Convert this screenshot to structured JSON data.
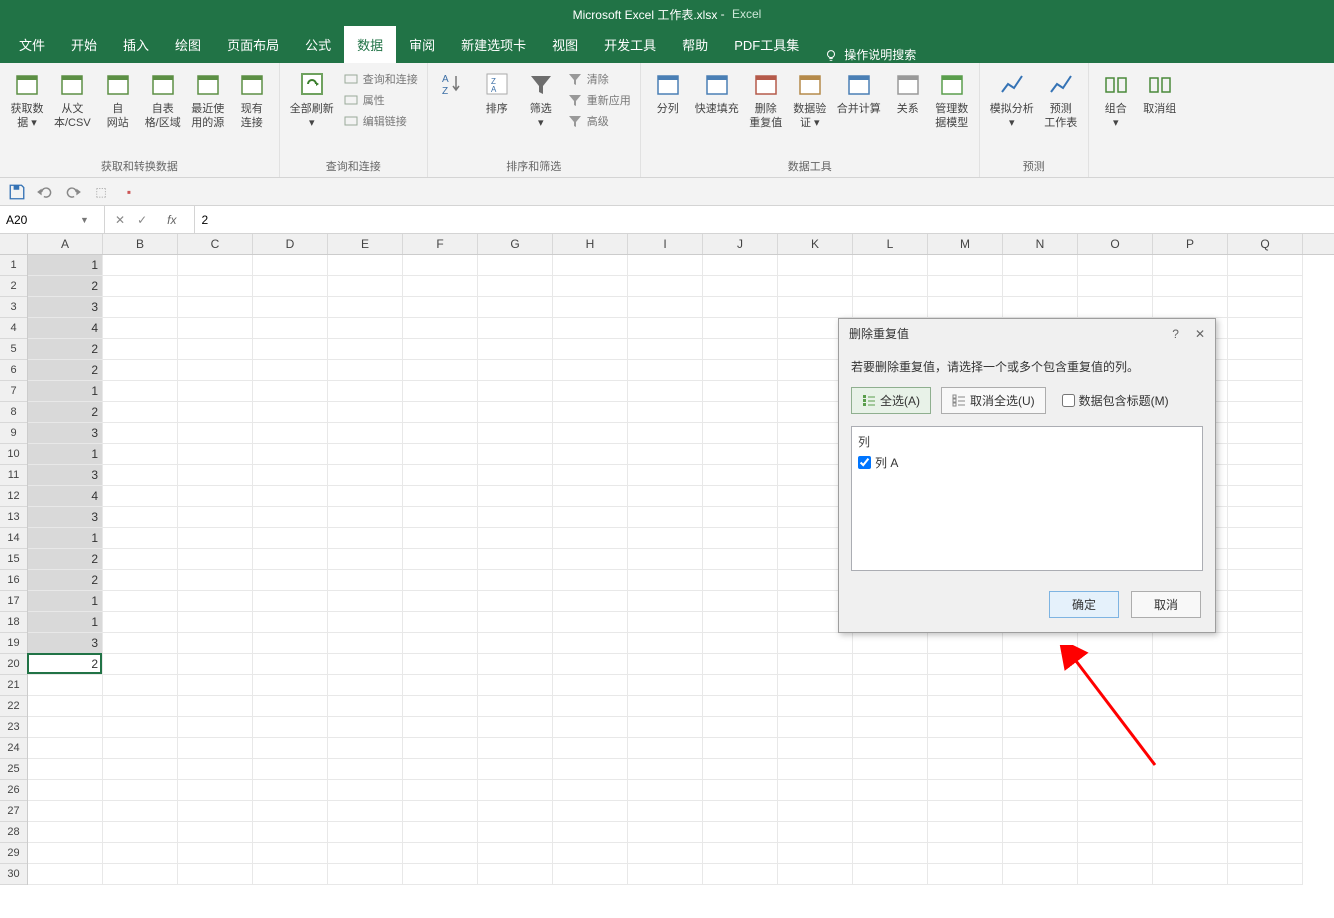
{
  "title": {
    "doc": "Microsoft Excel 工作表.xlsx",
    "app": "Excel"
  },
  "tabs": [
    "文件",
    "开始",
    "插入",
    "绘图",
    "页面布局",
    "公式",
    "数据",
    "审阅",
    "新建选项卡",
    "视图",
    "开发工具",
    "帮助",
    "PDF工具集"
  ],
  "active_tab_index": 6,
  "tellme": "操作说明搜索",
  "ribbon": {
    "group1": {
      "label": "获取和转换数据",
      "btns": [
        "获取数\n据 ▾",
        "从文\n本/CSV",
        "自\n网站",
        "自表\n格/区域",
        "最近使\n用的源",
        "现有\n连接"
      ]
    },
    "group2": {
      "label": "查询和连接",
      "refresh": "全部刷新\n▾",
      "items": [
        "查询和连接",
        "属性",
        "编辑链接"
      ]
    },
    "group3": {
      "label": "排序和筛选",
      "sort": "排序",
      "filter": "筛选\n▾",
      "items": [
        "清除",
        "重新应用",
        "高级"
      ]
    },
    "group4": {
      "label": "数据工具",
      "btns": [
        "分列",
        "快速填充",
        "删除\n重复值",
        "数据验\n证 ▾",
        "合并计算",
        "关系",
        "管理数\n据模型"
      ]
    },
    "group5": {
      "label": "预测",
      "btns": [
        "模拟分析\n▾",
        "预测\n工作表"
      ]
    },
    "group6": {
      "btns": [
        "组合\n▾",
        "取消组"
      ]
    }
  },
  "formula": {
    "name_box": "A20",
    "value": "2"
  },
  "columns": [
    "A",
    "B",
    "C",
    "D",
    "E",
    "F",
    "G",
    "H",
    "I",
    "J",
    "K",
    "L",
    "M",
    "N",
    "O",
    "P",
    "Q"
  ],
  "rows_count": 30,
  "col_a_values": [
    "1",
    "2",
    "3",
    "4",
    "2",
    "2",
    "1",
    "2",
    "3",
    "1",
    "3",
    "4",
    "3",
    "1",
    "2",
    "2",
    "1",
    "1",
    "3",
    "2"
  ],
  "active_cell_row": 20,
  "selection_rows": 19,
  "dialog": {
    "title": "删除重复值",
    "help": "?",
    "close": "✕",
    "msg": "若要删除重复值，请选择一个或多个包含重复值的列。",
    "select_all": "全选(A)",
    "unselect_all": "取消全选(U)",
    "has_headers": "数据包含标题(M)",
    "list_header": "列",
    "list_item": "列 A",
    "ok": "确定",
    "cancel": "取消"
  }
}
